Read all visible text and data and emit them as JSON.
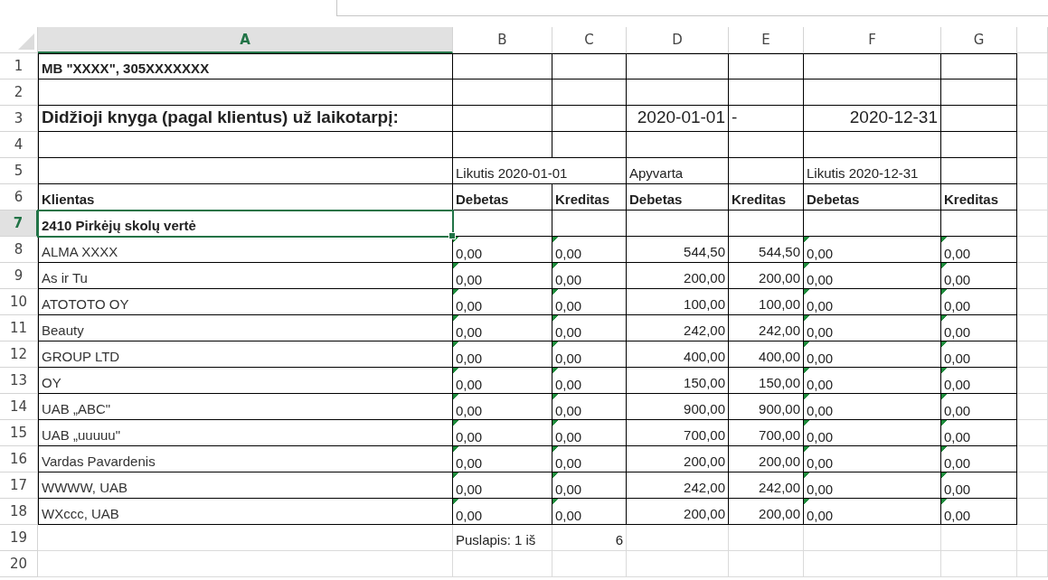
{
  "columns": [
    {
      "letter": "A",
      "selected": true
    },
    {
      "letter": "B",
      "selected": false
    },
    {
      "letter": "C",
      "selected": false
    },
    {
      "letter": "D",
      "selected": false
    },
    {
      "letter": "E",
      "selected": false
    },
    {
      "letter": "F",
      "selected": false
    },
    {
      "letter": "G",
      "selected": false
    }
  ],
  "rows": [
    {
      "number": "1",
      "selected": false,
      "kind": "heading",
      "bordered": true,
      "cells": [
        {
          "text": "MB \"XXXX\", 305XXXXXXX",
          "kind": "text",
          "flag": false
        },
        null,
        null,
        null,
        null,
        null,
        null
      ]
    },
    {
      "number": "2",
      "selected": false,
      "kind": "normal",
      "bordered": true,
      "cells": [
        null,
        null,
        null,
        null,
        null,
        null,
        null
      ]
    },
    {
      "number": "3",
      "selected": false,
      "kind": "title",
      "bordered": true,
      "cells": [
        {
          "text": "Didžioji knyga (pagal klientus) už laikotarpį:",
          "kind": "text",
          "flag": false
        },
        null,
        null,
        {
          "text": "2020-01-01",
          "kind": "number",
          "flag": false
        },
        {
          "text": "-",
          "kind": "text",
          "flag": false
        },
        {
          "text": "2020-12-31",
          "kind": "number",
          "flag": false
        },
        null
      ]
    },
    {
      "number": "4",
      "selected": false,
      "kind": "normal",
      "bordered": true,
      "cells": [
        null,
        null,
        null,
        null,
        null,
        null,
        null
      ]
    },
    {
      "number": "5",
      "selected": false,
      "kind": "normal",
      "bordered": true,
      "cells": [
        null,
        {
          "text": "Likutis 2020-01-01",
          "kind": "text",
          "flag": false
        },
        null,
        {
          "text": "Apyvarta",
          "kind": "text",
          "flag": false
        },
        null,
        {
          "text": "Likutis 2020-12-31",
          "kind": "text",
          "flag": false
        },
        null
      ]
    },
    {
      "number": "6",
      "selected": false,
      "kind": "heading",
      "bordered": true,
      "cells": [
        {
          "text": "Klientas",
          "kind": "text",
          "flag": false
        },
        {
          "text": "Debetas",
          "kind": "text",
          "flag": false
        },
        {
          "text": "Kreditas",
          "kind": "text",
          "flag": false
        },
        {
          "text": "Debetas",
          "kind": "text",
          "flag": false
        },
        {
          "text": "Kreditas",
          "kind": "text",
          "flag": false
        },
        {
          "text": "Debetas",
          "kind": "text",
          "flag": false
        },
        {
          "text": "Kreditas",
          "kind": "text",
          "flag": false
        }
      ]
    },
    {
      "number": "7",
      "selected": true,
      "kind": "heading",
      "bordered": true,
      "cells": [
        {
          "text": "2410 Pirkėjų skolų vertė",
          "kind": "text",
          "flag": false
        },
        null,
        null,
        null,
        null,
        null,
        null
      ]
    },
    {
      "number": "8",
      "selected": false,
      "kind": "normal",
      "bordered": true,
      "cells": [
        {
          "text": "ALMA XXXX",
          "kind": "text",
          "flag": false
        },
        {
          "text": "0,00",
          "kind": "number",
          "flag": true
        },
        {
          "text": "0,00",
          "kind": "number",
          "flag": true
        },
        {
          "text": "544,50",
          "kind": "number",
          "flag": false
        },
        {
          "text": "544,50",
          "kind": "number",
          "flag": false
        },
        {
          "text": "0,00",
          "kind": "number",
          "flag": true
        },
        {
          "text": "0,00",
          "kind": "number",
          "flag": true
        }
      ]
    },
    {
      "number": "9",
      "selected": false,
      "kind": "normal",
      "bordered": true,
      "cells": [
        {
          "text": "As ir Tu",
          "kind": "text",
          "flag": false
        },
        {
          "text": "0,00",
          "kind": "number",
          "flag": true
        },
        {
          "text": "0,00",
          "kind": "number",
          "flag": true
        },
        {
          "text": "200,00",
          "kind": "number",
          "flag": false
        },
        {
          "text": "200,00",
          "kind": "number",
          "flag": false
        },
        {
          "text": "0,00",
          "kind": "number",
          "flag": true
        },
        {
          "text": "0,00",
          "kind": "number",
          "flag": true
        }
      ]
    },
    {
      "number": "10",
      "selected": false,
      "kind": "normal",
      "bordered": true,
      "cells": [
        {
          "text": "ATOTOTO OY",
          "kind": "text",
          "flag": false
        },
        {
          "text": "0,00",
          "kind": "number",
          "flag": true
        },
        {
          "text": "0,00",
          "kind": "number",
          "flag": true
        },
        {
          "text": "100,00",
          "kind": "number",
          "flag": false
        },
        {
          "text": "100,00",
          "kind": "number",
          "flag": false
        },
        {
          "text": "0,00",
          "kind": "number",
          "flag": true
        },
        {
          "text": "0,00",
          "kind": "number",
          "flag": true
        }
      ]
    },
    {
      "number": "11",
      "selected": false,
      "kind": "normal",
      "bordered": true,
      "cells": [
        {
          "text": "Beauty",
          "kind": "text",
          "flag": false
        },
        {
          "text": "0,00",
          "kind": "number",
          "flag": true
        },
        {
          "text": "0,00",
          "kind": "number",
          "flag": true
        },
        {
          "text": "242,00",
          "kind": "number",
          "flag": false
        },
        {
          "text": "242,00",
          "kind": "number",
          "flag": false
        },
        {
          "text": "0,00",
          "kind": "number",
          "flag": true
        },
        {
          "text": "0,00",
          "kind": "number",
          "flag": true
        }
      ]
    },
    {
      "number": "12",
      "selected": false,
      "kind": "normal",
      "bordered": true,
      "cells": [
        {
          "text": "GROUP LTD",
          "kind": "text",
          "flag": false
        },
        {
          "text": "0,00",
          "kind": "number",
          "flag": true
        },
        {
          "text": "0,00",
          "kind": "number",
          "flag": true
        },
        {
          "text": "400,00",
          "kind": "number",
          "flag": false
        },
        {
          "text": "400,00",
          "kind": "number",
          "flag": false
        },
        {
          "text": "0,00",
          "kind": "number",
          "flag": true
        },
        {
          "text": "0,00",
          "kind": "number",
          "flag": true
        }
      ]
    },
    {
      "number": "13",
      "selected": false,
      "kind": "normal",
      "bordered": true,
      "cells": [
        {
          "text": "OY",
          "kind": "text",
          "flag": false
        },
        {
          "text": "0,00",
          "kind": "number",
          "flag": true
        },
        {
          "text": "0,00",
          "kind": "number",
          "flag": true
        },
        {
          "text": "150,00",
          "kind": "number",
          "flag": false
        },
        {
          "text": "150,00",
          "kind": "number",
          "flag": false
        },
        {
          "text": "0,00",
          "kind": "number",
          "flag": true
        },
        {
          "text": "0,00",
          "kind": "number",
          "flag": true
        }
      ]
    },
    {
      "number": "14",
      "selected": false,
      "kind": "normal",
      "bordered": true,
      "cells": [
        {
          "text": "UAB „ABC\"",
          "kind": "text",
          "flag": false
        },
        {
          "text": "0,00",
          "kind": "number",
          "flag": true
        },
        {
          "text": "0,00",
          "kind": "number",
          "flag": true
        },
        {
          "text": "900,00",
          "kind": "number",
          "flag": false
        },
        {
          "text": "900,00",
          "kind": "number",
          "flag": false
        },
        {
          "text": "0,00",
          "kind": "number",
          "flag": true
        },
        {
          "text": "0,00",
          "kind": "number",
          "flag": true
        }
      ]
    },
    {
      "number": "15",
      "selected": false,
      "kind": "normal",
      "bordered": true,
      "cells": [
        {
          "text": "UAB „uuuuu\"",
          "kind": "text",
          "flag": false
        },
        {
          "text": "0,00",
          "kind": "number",
          "flag": true
        },
        {
          "text": "0,00",
          "kind": "number",
          "flag": true
        },
        {
          "text": "700,00",
          "kind": "number",
          "flag": false
        },
        {
          "text": "700,00",
          "kind": "number",
          "flag": false
        },
        {
          "text": "0,00",
          "kind": "number",
          "flag": true
        },
        {
          "text": "0,00",
          "kind": "number",
          "flag": true
        }
      ]
    },
    {
      "number": "16",
      "selected": false,
      "kind": "normal",
      "bordered": true,
      "cells": [
        {
          "text": "Vardas Pavardenis",
          "kind": "text",
          "flag": false
        },
        {
          "text": "0,00",
          "kind": "number",
          "flag": true
        },
        {
          "text": "0,00",
          "kind": "number",
          "flag": true
        },
        {
          "text": "200,00",
          "kind": "number",
          "flag": false
        },
        {
          "text": "200,00",
          "kind": "number",
          "flag": false
        },
        {
          "text": "0,00",
          "kind": "number",
          "flag": true
        },
        {
          "text": "0,00",
          "kind": "number",
          "flag": true
        }
      ]
    },
    {
      "number": "17",
      "selected": false,
      "kind": "normal",
      "bordered": true,
      "cells": [
        {
          "text": "WWWW, UAB",
          "kind": "text",
          "flag": false
        },
        {
          "text": "0,00",
          "kind": "number",
          "flag": true
        },
        {
          "text": "0,00",
          "kind": "number",
          "flag": true
        },
        {
          "text": "242,00",
          "kind": "number",
          "flag": false
        },
        {
          "text": "242,00",
          "kind": "number",
          "flag": false
        },
        {
          "text": "0,00",
          "kind": "number",
          "flag": true
        },
        {
          "text": "0,00",
          "kind": "number",
          "flag": true
        }
      ]
    },
    {
      "number": "18",
      "selected": false,
      "kind": "normal",
      "bordered": true,
      "cells": [
        {
          "text": "WXccc, UAB",
          "kind": "text",
          "flag": false
        },
        {
          "text": "0,00",
          "kind": "number",
          "flag": true
        },
        {
          "text": "0,00",
          "kind": "number",
          "flag": true
        },
        {
          "text": "200,00",
          "kind": "number",
          "flag": false
        },
        {
          "text": "200,00",
          "kind": "number",
          "flag": false
        },
        {
          "text": "0,00",
          "kind": "number",
          "flag": true
        },
        {
          "text": "0,00",
          "kind": "number",
          "flag": true
        }
      ]
    },
    {
      "number": "19",
      "selected": false,
      "kind": "normal",
      "bordered": false,
      "cells": [
        null,
        {
          "text": "Puslapis: 1 iš",
          "kind": "text",
          "flag": false
        },
        {
          "text": "6",
          "kind": "number",
          "flag": false
        },
        null,
        null,
        null,
        null
      ]
    },
    {
      "number": "20",
      "selected": false,
      "kind": "normal",
      "bordered": false,
      "cells": [
        null,
        null,
        null,
        null,
        null,
        null,
        null
      ]
    }
  ]
}
